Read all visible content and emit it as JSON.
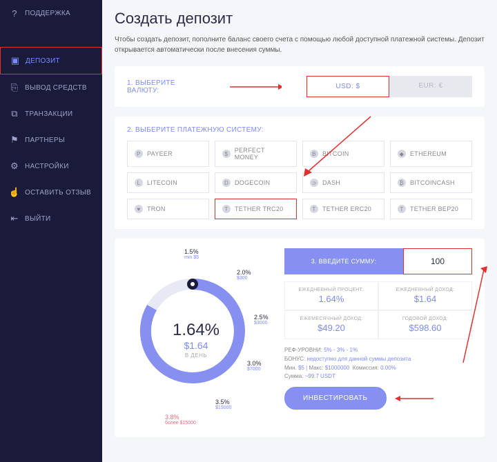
{
  "sidebar": {
    "items": [
      {
        "icon": "?",
        "label": "ПОДДЕРЖКА"
      },
      {
        "icon": "▣",
        "label": "ДЕПОЗИТ"
      },
      {
        "icon": "⎘",
        "label": "ВЫВОД СРЕДСТВ"
      },
      {
        "icon": "⧉",
        "label": "ТРАНЗАКЦИИ"
      },
      {
        "icon": "⚑",
        "label": "ПАРТНЕРЫ"
      },
      {
        "icon": "⚙",
        "label": "НАСТРОЙКИ"
      },
      {
        "icon": "☝",
        "label": "ОСТАВИТЬ ОТЗЫВ"
      },
      {
        "icon": "⇤",
        "label": "ВЫЙТИ"
      }
    ]
  },
  "page": {
    "title": "Создать депозит",
    "intro": "Чтобы создать депозит, пополните баланс своего счета с помощью любой доступной платежной системы. Депозит открывается автоматически после внесения суммы."
  },
  "step1": {
    "label": "1. ВЫБЕРИТЕ ВАЛЮТУ:",
    "usd": "USD: $",
    "eur": "EUR: €"
  },
  "step2": {
    "label": "2. ВЫБЕРИТЕ ПЛАТЕЖНУЮ СИСТЕМУ:",
    "options": [
      "PAYEER",
      "PERFECT MONEY",
      "BITCOIN",
      "ETHEREUM",
      "LITECOIN",
      "DOGECOIN",
      "DASH",
      "BITCOINCASH",
      "TRON",
      "TETHER TRC20",
      "TETHER ERC20",
      "TETHER BEP20"
    ],
    "option_icons": [
      "P",
      "$",
      "B",
      "◆",
      "L",
      "D",
      "⊃",
      "₿",
      "♥",
      "T",
      "T",
      "T"
    ],
    "selected": 9
  },
  "step3": {
    "label": "3. ВВЕДИТЕ СУММУ:",
    "amount": "100"
  },
  "dial": {
    "pct": "1.64%",
    "amt": "$1.64",
    "perday": "В ДЕНЬ",
    "ticks": {
      "t15": {
        "p": "1.5%",
        "s": "min $5"
      },
      "t20": {
        "p": "2.0%",
        "s": "$300"
      },
      "t25": {
        "p": "2.5%",
        "s": "$3000"
      },
      "t30": {
        "p": "3.0%",
        "s": "$7000"
      },
      "t35": {
        "p": "3.5%",
        "s": "$15000"
      },
      "t38": {
        "p": "3.8%",
        "s": "более $15000"
      }
    }
  },
  "stats": {
    "s1": {
      "lbl": "ЕЖЕДНЕВНЫЙ ПРОЦЕНТ:",
      "val": "1.64%"
    },
    "s2": {
      "lbl": "ЕЖЕДНЕВНЫЙ ДОХОД:",
      "val": "$1.64"
    },
    "s3": {
      "lbl": "ЕЖЕМЕСЯЧНЫЙ ДОХОД:",
      "val": "$49.20"
    },
    "s4": {
      "lbl": "ГОДОВОЙ ДОХОД:",
      "val": "$598.60"
    }
  },
  "meta": {
    "ref_k": "РЕФ-УРОВНИ:",
    "ref_v": "5% - 3% - 1%",
    "bonus_k": "БОНУС:",
    "bonus_v": "недоступно для данной суммы депозита",
    "min_k": "Мин.",
    "min_v": "$5",
    "max_k": "Макс:",
    "max_v": "$1000000",
    "com_k": "Комиссия:",
    "com_v": "0.00%",
    "sum_k": "Сумма:",
    "sum_v": "~99.7 USDT"
  },
  "invest": "ИНВЕСТИРОВАТЬ"
}
